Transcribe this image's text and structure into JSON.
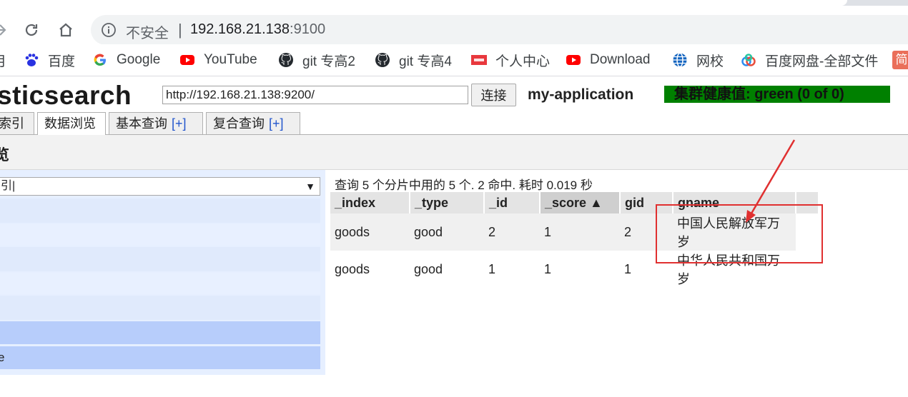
{
  "browser": {
    "security_label": "不安全",
    "separator": "|",
    "url_host": "192.168.21.138",
    "url_port": ":9100",
    "bookmarks": [
      {
        "label": "月",
        "icon": "bookmark-app-icon"
      },
      {
        "label": "百度",
        "icon": "baidu-paw-icon"
      },
      {
        "label": "Google",
        "icon": "google-icon"
      },
      {
        "label": "YouTube",
        "icon": "youtube-icon"
      },
      {
        "label": "git 专高2",
        "icon": "github-icon"
      },
      {
        "label": "git 专高4",
        "icon": "github-icon"
      },
      {
        "label": "个人中心",
        "icon": "toutiao-icon"
      },
      {
        "label": "Download",
        "icon": "youtube-icon"
      },
      {
        "label": "网校",
        "icon": "globe-icon"
      },
      {
        "label": "百度网盘-全部文件",
        "icon": "baidu-netdisk-icon"
      },
      {
        "label": "简",
        "icon": "jianshu-icon"
      }
    ]
  },
  "app": {
    "logo": "sticsearch",
    "connection_url": "http://192.168.21.138:9200/",
    "connect_button": "连接",
    "cluster_name": "my-application",
    "cluster_health": "集群健康值: green (0 of 0)",
    "health_color": "#008000",
    "tabs": [
      {
        "label": "索引",
        "plus": ""
      },
      {
        "label": "数据浏览",
        "plus": ""
      },
      {
        "label": "基本查询",
        "plus": "[+]"
      },
      {
        "label": "复合查询",
        "plus": "[+]"
      }
    ],
    "section_title": "览",
    "sidebar": {
      "select_value": "引|",
      "select_arrow": "▼",
      "last_row_label": "e"
    },
    "result_info": "查询 5 个分片中用的 5 个. 2 命中. 耗时 0.019 秒",
    "table": {
      "headers": [
        "_index",
        "_type",
        "_id",
        "_score ▲",
        "gid",
        "gname"
      ],
      "rows": [
        [
          "goods",
          "good",
          "2",
          "1",
          "2",
          "中国人民解放军万岁"
        ],
        [
          "goods",
          "good",
          "1",
          "1",
          "1",
          "中华人民共和国万岁"
        ]
      ]
    },
    "annotation_color": "#e03030"
  }
}
